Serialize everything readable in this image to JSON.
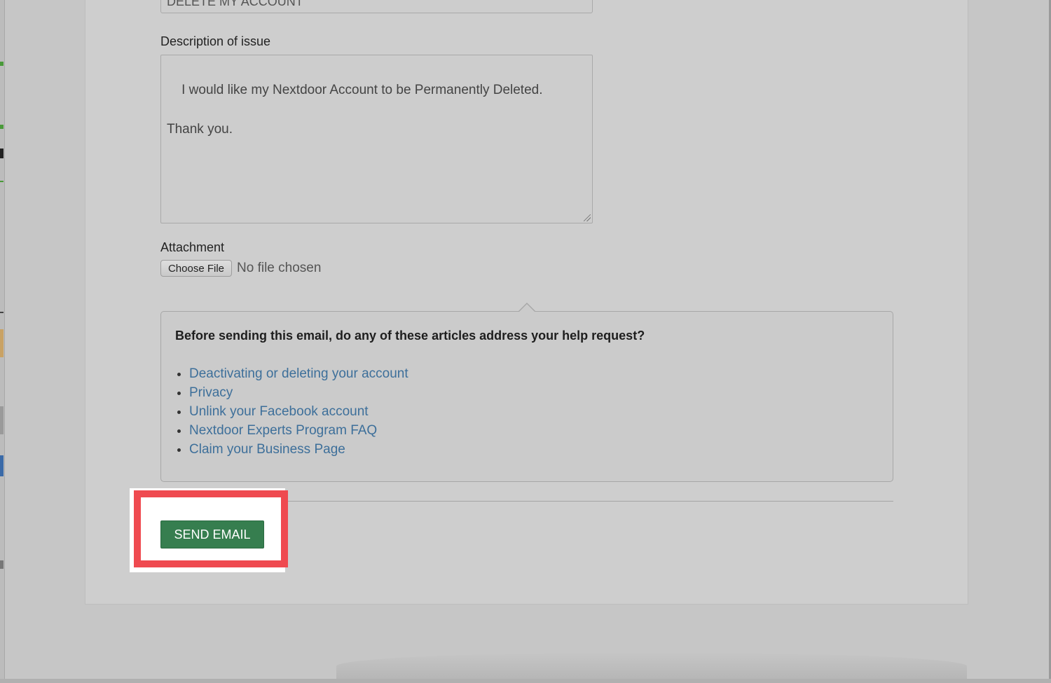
{
  "form": {
    "subject_value": "DELETE MY ACCOUNT",
    "description_label": "Description of issue",
    "description_value": "I would like my Nextdoor Account to be Permanently Deleted.\n\nThank you.",
    "attachment_label": "Attachment",
    "choose_file_label": "Choose File",
    "file_status": "No file chosen"
  },
  "articles": {
    "title": "Before sending this email, do any of these articles address your help request?",
    "items": [
      {
        "label": "Deactivating or deleting your account"
      },
      {
        "label": "Privacy"
      },
      {
        "label": "Unlink your Facebook account"
      },
      {
        "label": "Nextdoor Experts Program FAQ"
      },
      {
        "label": "Claim your Business Page"
      }
    ]
  },
  "actions": {
    "send_label": "SEND EMAIL"
  },
  "colors": {
    "send_button": "#367e4f",
    "link": "#3d6f9a",
    "highlight": "#ef4a50"
  }
}
